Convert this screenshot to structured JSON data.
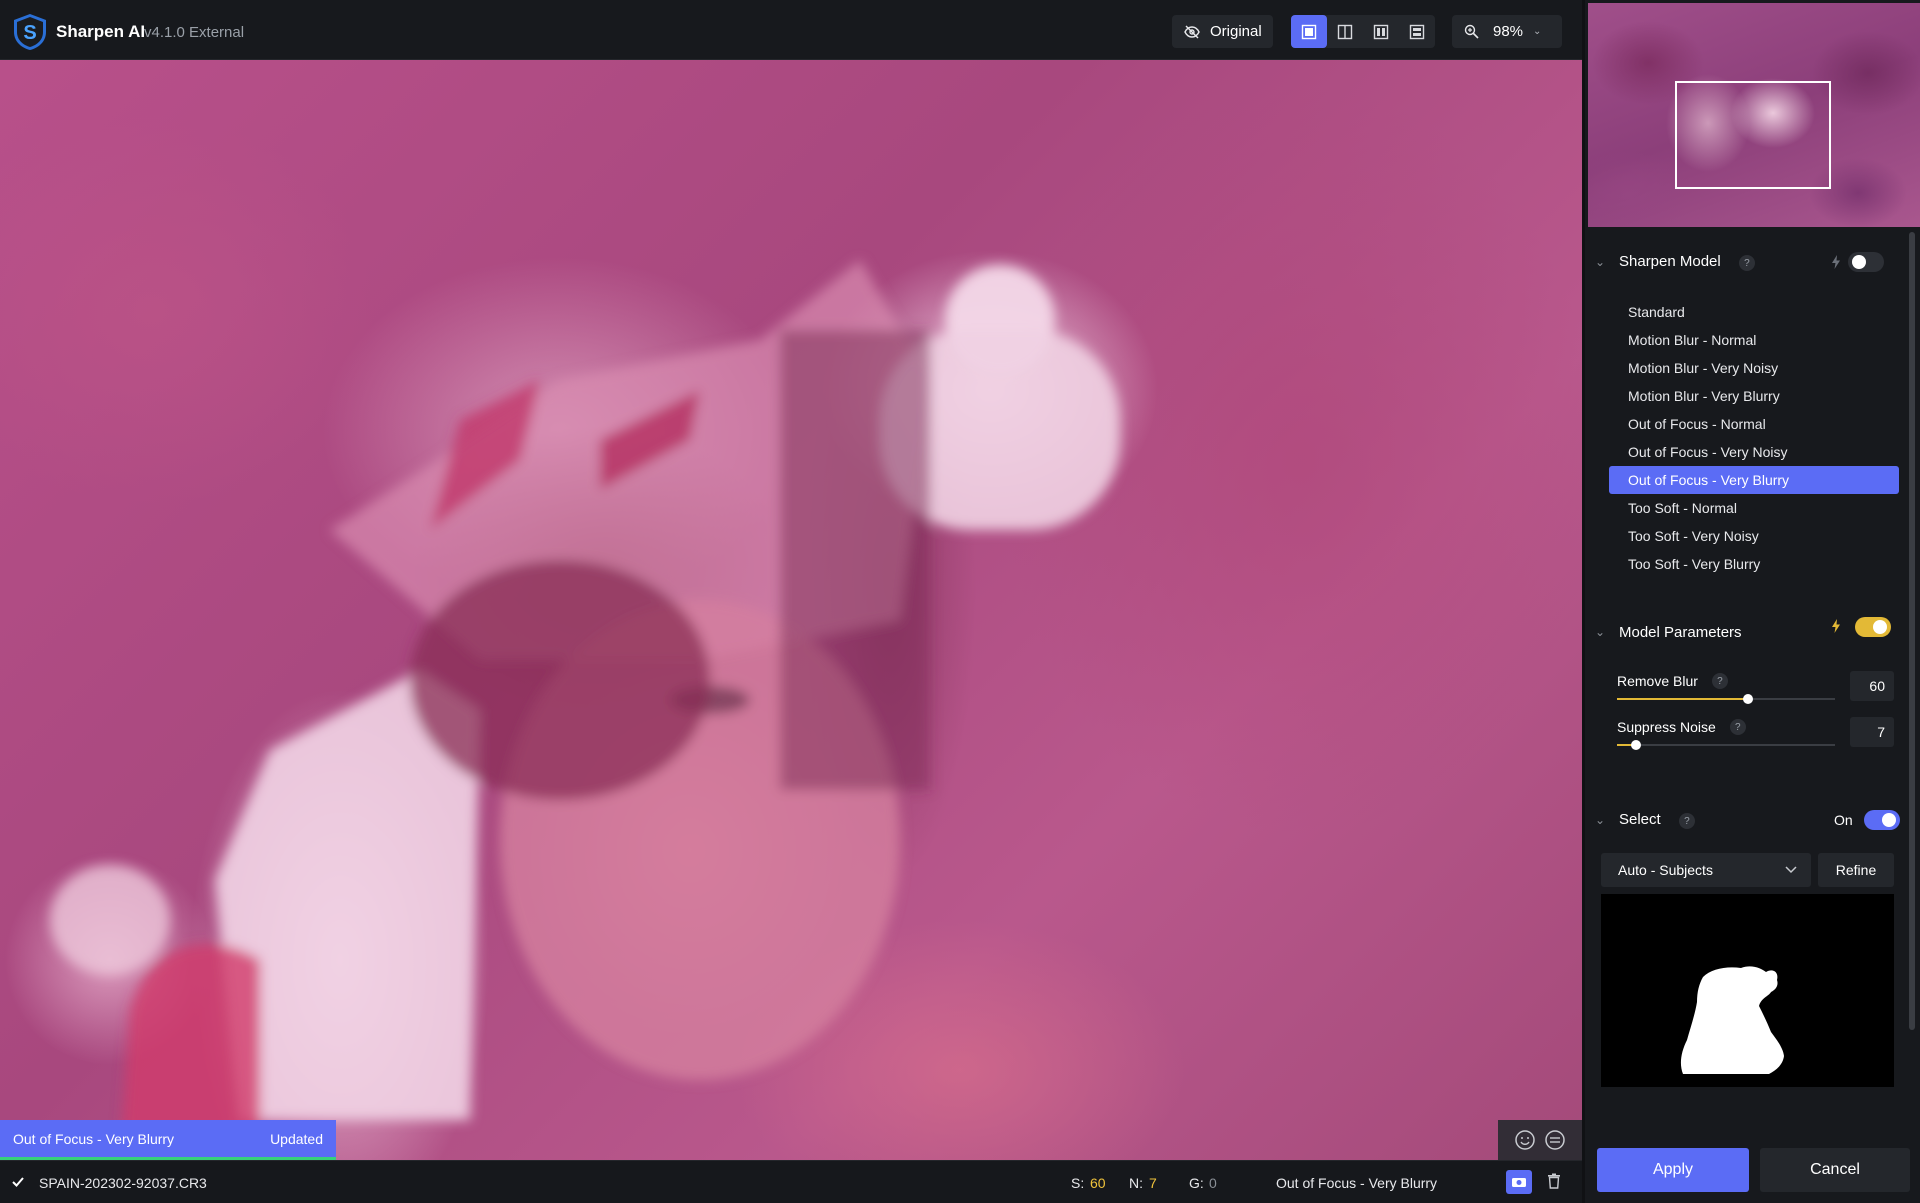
{
  "app": {
    "title": "Sharpen AI",
    "version": "v4.1.0 External"
  },
  "toolbar": {
    "original_label": "Original",
    "zoom": "98%"
  },
  "canvas": {
    "status_model": "Out of Focus - Very Blurry",
    "status_state": "Updated"
  },
  "bottombar": {
    "filename": "SPAIN-202302-92037.CR3",
    "s_label": "S:",
    "s_value": "60",
    "n_label": "N:",
    "n_value": "7",
    "g_label": "G:",
    "g_value": "0",
    "model": "Out of Focus - Very Blurry"
  },
  "sharpen_model": {
    "title": "Sharpen Model",
    "help": "?",
    "auto_toggle": false,
    "items": [
      {
        "label": "Standard",
        "selected": false
      },
      {
        "label": "Motion Blur - Normal",
        "selected": false
      },
      {
        "label": "Motion Blur - Very Noisy",
        "selected": false
      },
      {
        "label": "Motion Blur - Very Blurry",
        "selected": false
      },
      {
        "label": "Out of Focus - Normal",
        "selected": false
      },
      {
        "label": "Out of Focus - Very Noisy",
        "selected": false
      },
      {
        "label": "Out of Focus - Very Blurry",
        "selected": true
      },
      {
        "label": "Too Soft - Normal",
        "selected": false
      },
      {
        "label": "Too Soft - Very Noisy",
        "selected": false
      },
      {
        "label": "Too Soft - Very Blurry",
        "selected": false
      }
    ]
  },
  "model_parameters": {
    "title": "Model Parameters",
    "auto_toggle": true,
    "remove_blur": {
      "label": "Remove Blur",
      "help": "?",
      "value": "60",
      "fraction": 0.6
    },
    "suppress_noise": {
      "label": "Suppress Noise",
      "help": "?",
      "value": "7",
      "fraction": 0.07
    }
  },
  "select": {
    "title": "Select",
    "help": "?",
    "state_label": "On",
    "enabled": true,
    "mode": "Auto - Subjects",
    "refine_label": "Refine"
  },
  "actions": {
    "apply": "Apply",
    "cancel": "Cancel"
  },
  "colors": {
    "accent": "#5b6cf5",
    "warning": "#e3b936",
    "success": "#37d37a",
    "background": "#17191d"
  }
}
